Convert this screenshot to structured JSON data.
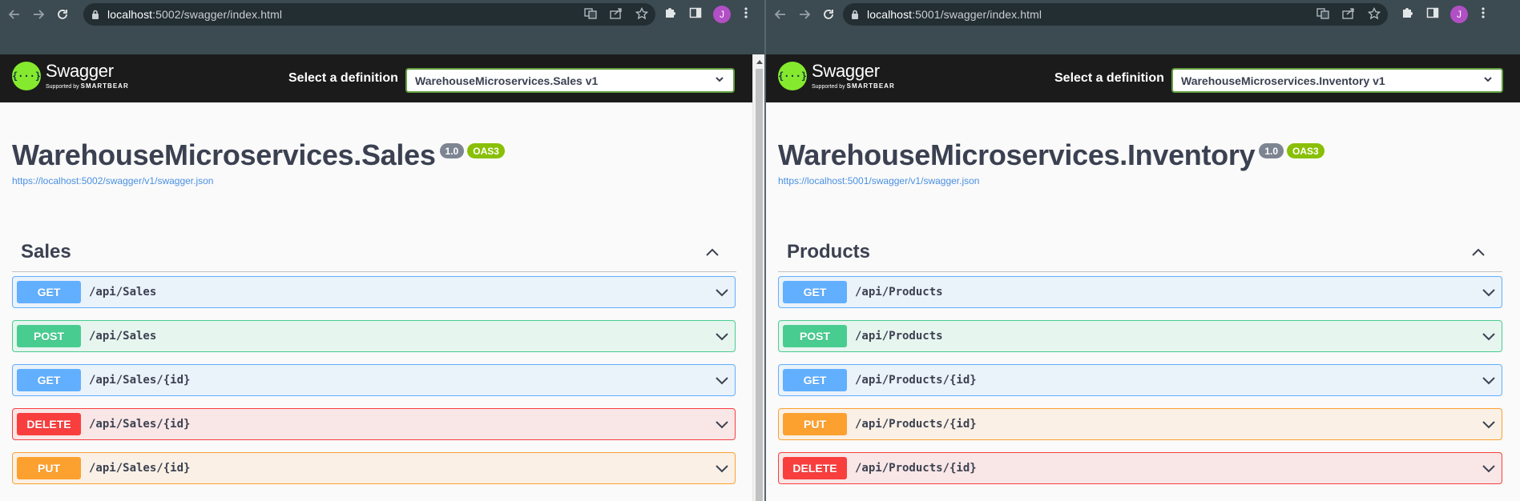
{
  "left": {
    "url_host": "localhost",
    "url_path": ":5002/swagger/index.html",
    "brand": "Swagger",
    "brand_sub_prefix": "Supported by",
    "brand_sub_company": "SMARTBEAR",
    "select_label": "Select a definition",
    "selected_definition": "WarehouseMicroservices.Sales v1",
    "title": "WarehouseMicroservices.Sales",
    "version": "1.0",
    "oas": "OAS3",
    "spec_url": "https://localhost:5002/swagger/v1/swagger.json",
    "tag": "Sales",
    "avatar": "J",
    "operations": [
      {
        "method": "GET",
        "path": "/api/Sales"
      },
      {
        "method": "POST",
        "path": "/api/Sales"
      },
      {
        "method": "GET",
        "path": "/api/Sales/{id}"
      },
      {
        "method": "DELETE",
        "path": "/api/Sales/{id}"
      },
      {
        "method": "PUT",
        "path": "/api/Sales/{id}"
      }
    ]
  },
  "right": {
    "url_host": "localhost",
    "url_path": ":5001/swagger/index.html",
    "brand": "Swagger",
    "brand_sub_prefix": "Supported by",
    "brand_sub_company": "SMARTBEAR",
    "select_label": "Select a definition",
    "selected_definition": "WarehouseMicroservices.Inventory v1",
    "title": "WarehouseMicroservices.Inventory",
    "version": "1.0",
    "oas": "OAS3",
    "spec_url": "https://localhost:5001/swagger/v1/swagger.json",
    "tag": "Products",
    "avatar": "J",
    "operations": [
      {
        "method": "GET",
        "path": "/api/Products"
      },
      {
        "method": "POST",
        "path": "/api/Products"
      },
      {
        "method": "GET",
        "path": "/api/Products/{id}"
      },
      {
        "method": "PUT",
        "path": "/api/Products/{id}"
      },
      {
        "method": "DELETE",
        "path": "/api/Products/{id}"
      }
    ]
  },
  "colors": {
    "get": "#61affe",
    "post": "#49cc90",
    "put": "#fca130",
    "delete": "#f93e3e",
    "swagger_green": "#85ea2d",
    "topbar": "#1b1b1b"
  },
  "icons": {
    "back": "arrow-left-icon",
    "forward": "arrow-right-icon",
    "reload": "reload-icon",
    "lock": "lock-icon",
    "translate": "translate-icon",
    "share": "share-icon",
    "bookmark": "star-icon",
    "extensions": "puzzle-icon",
    "side_panel": "side-panel-icon",
    "menu": "kebab-menu-icon"
  }
}
